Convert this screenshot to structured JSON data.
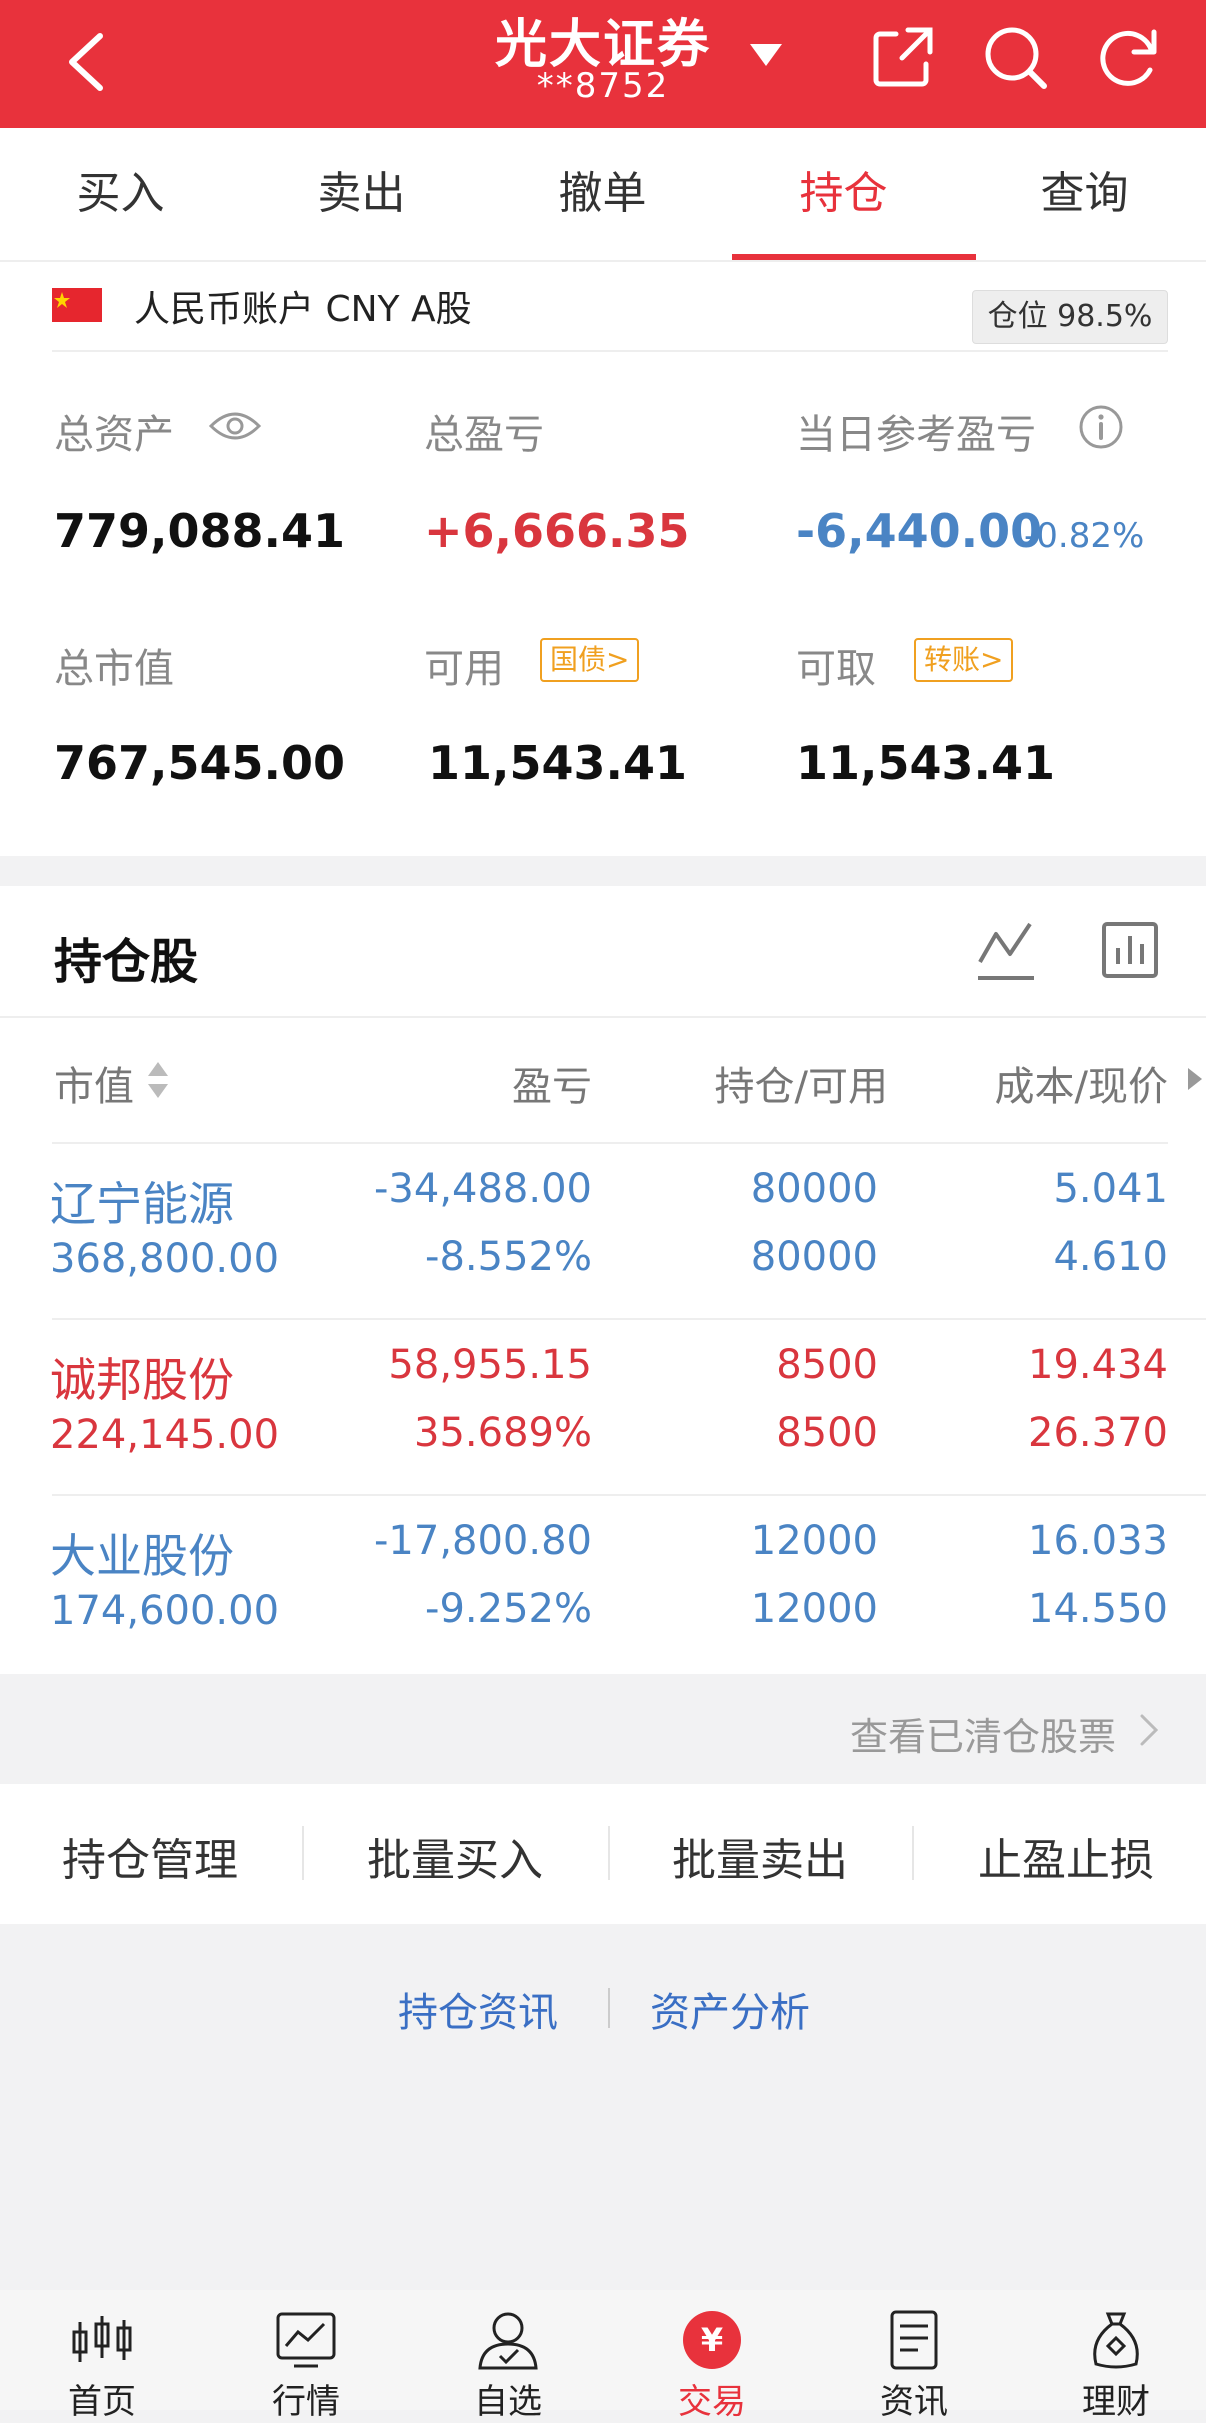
{
  "header": {
    "title": "光大证券",
    "account_masked": "**8752",
    "colors": {
      "brand": "#e8323c",
      "gain": "#d9363e",
      "loss": "#4a84c4",
      "link": "#3a6fc4",
      "tag": "#f0a020"
    }
  },
  "tabs": [
    {
      "label": "买入"
    },
    {
      "label": "卖出"
    },
    {
      "label": "撤单"
    },
    {
      "label": "持仓",
      "active": true
    },
    {
      "label": "查询"
    }
  ],
  "account": {
    "label": "人民币账户 CNY A股",
    "position_label": "仓位 98.5%"
  },
  "stats": {
    "total_assets_label": "总资产",
    "total_assets": "779,088.41",
    "total_pnl_label": "总盈亏",
    "total_pnl": "+6,666.35",
    "daily_pnl_label": "当日参考盈亏",
    "daily_pnl": "-6,440.00",
    "daily_pnl_pct": "-0.82%",
    "market_value_label": "总市值",
    "market_value": "767,545.00",
    "available_label": "可用",
    "available_tag": "国债>",
    "available": "11,543.41",
    "withdrawable_label": "可取",
    "withdrawable_tag": "转账>",
    "withdrawable": "11,543.41"
  },
  "holdings": {
    "title": "持仓股",
    "columns": [
      "市值",
      "盈亏",
      "持仓/可用",
      "成本/现价"
    ],
    "rows": [
      {
        "name": "辽宁能源",
        "market_value": "368,800.00",
        "pnl": "-34,488.00",
        "pnl_pct": "-8.552%",
        "position": "80000",
        "available": "80000",
        "cost": "5.041",
        "price": "4.610",
        "trend": "loss"
      },
      {
        "name": "诚邦股份",
        "market_value": "224,145.00",
        "pnl": "58,955.15",
        "pnl_pct": "35.689%",
        "position": "8500",
        "available": "8500",
        "cost": "19.434",
        "price": "26.370",
        "trend": "gain"
      },
      {
        "name": "大业股份",
        "market_value": "174,600.00",
        "pnl": "-17,800.80",
        "pnl_pct": "-9.252%",
        "position": "12000",
        "available": "12000",
        "cost": "16.033",
        "price": "14.550",
        "trend": "loss"
      }
    ],
    "cleared_link": "查看已清仓股票"
  },
  "actions": [
    "持仓管理",
    "批量买入",
    "批量卖出",
    "止盈止损"
  ],
  "links": [
    "持仓资讯",
    "资产分析"
  ],
  "bottom_nav": [
    {
      "label": "首页",
      "icon": "home-candlestick-icon"
    },
    {
      "label": "行情",
      "icon": "market-chart-icon"
    },
    {
      "label": "自选",
      "icon": "watchlist-user-icon"
    },
    {
      "label": "交易",
      "icon": "trade-yuan-icon",
      "active": true
    },
    {
      "label": "资讯",
      "icon": "news-document-icon"
    },
    {
      "label": "理财",
      "icon": "wealth-bag-icon"
    }
  ]
}
